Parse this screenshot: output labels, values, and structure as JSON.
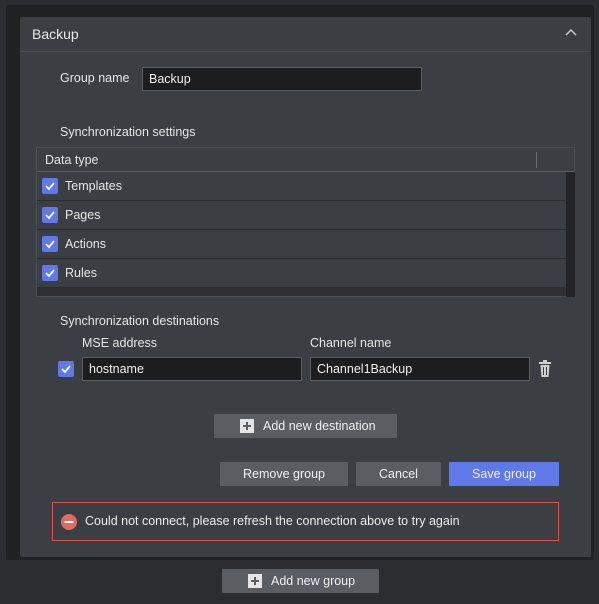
{
  "group": {
    "title": "Backup",
    "group_name_label": "Group name",
    "group_name_value": "Backup",
    "sync_settings_label": "Synchronization settings",
    "table": {
      "column_header": "Data type",
      "rows": [
        {
          "label": "Templates",
          "checked": true
        },
        {
          "label": "Pages",
          "checked": true
        },
        {
          "label": "Actions",
          "checked": true
        },
        {
          "label": "Rules",
          "checked": true
        }
      ]
    },
    "sync_destinations_label": "Synchronization destinations",
    "mse_address_label": "MSE address",
    "channel_name_label": "Channel name",
    "destination": {
      "checked": true,
      "mse_address": "hostname",
      "channel_name": "Channel1Backup"
    },
    "add_destination_label": "Add new destination",
    "remove_group_label": "Remove group",
    "cancel_label": "Cancel",
    "save_group_label": "Save group",
    "error_message": "Could not connect, please refresh the connection above to try again"
  },
  "add_group_label": "Add new group",
  "icons": {
    "collapse": "chevron-up-icon",
    "checkbox": "checkmark-icon",
    "delete": "trash-icon",
    "add": "plus-square-icon",
    "error": "minus-circle-icon"
  },
  "colors": {
    "accent": "#6079e8",
    "error": "#d9534f",
    "panel": "#3b3e42",
    "background": "#2b2d30"
  }
}
